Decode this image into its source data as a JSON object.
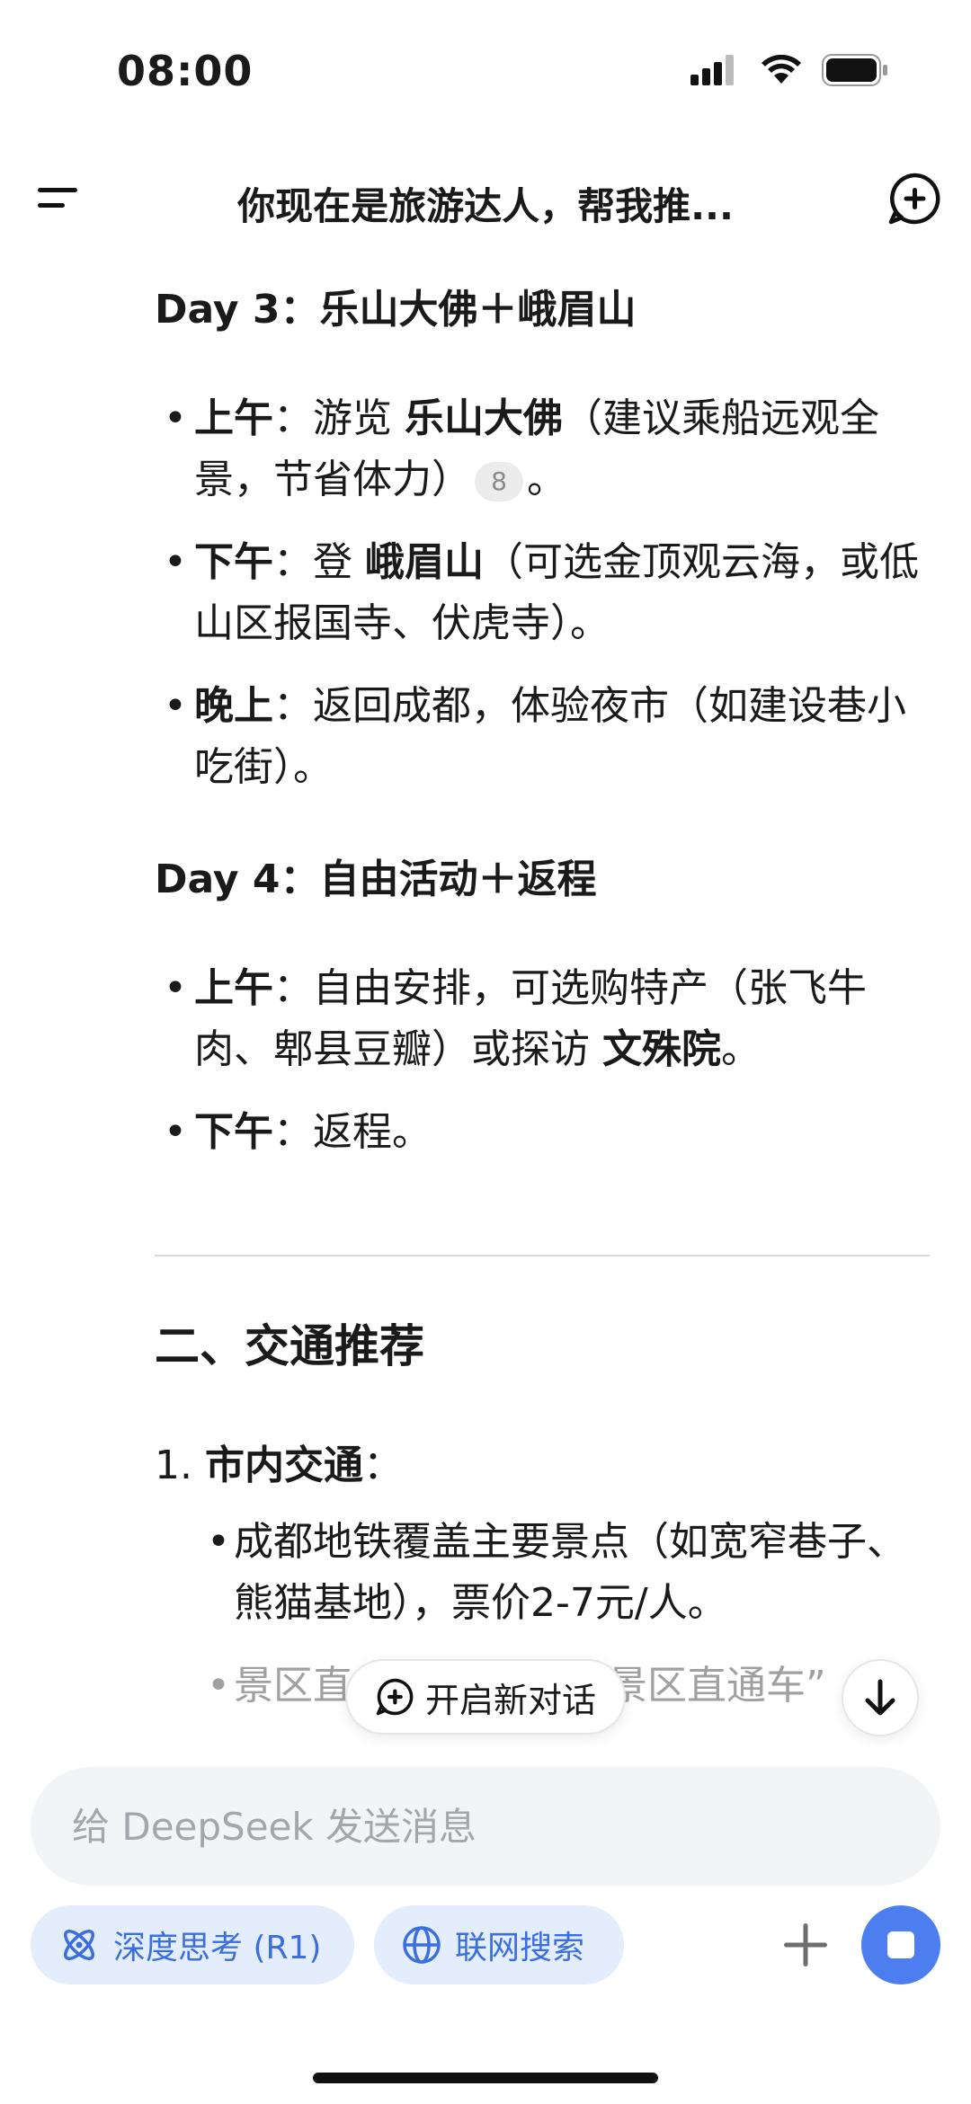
{
  "status_bar": {
    "time": "08:00"
  },
  "header": {
    "title": "你现在是旅游达人，帮我推..."
  },
  "content": {
    "day3": {
      "title": "Day 3：乐山大佛＋峨眉山",
      "items": [
        {
          "label": "上午",
          "sep": "：游览 ",
          "bold": "乐山大佛",
          "text": "（建议乘船远观全景，节省体力）",
          "cite": "8",
          "tail": "。"
        },
        {
          "label": "下午",
          "sep": "：登 ",
          "bold": "峨眉山",
          "text": "（可选金顶观云海，或低山区报国寺、伏虎寺）。"
        },
        {
          "label": "晚上",
          "text": "：返回成都，体验夜市（如建设巷小吃街）。"
        }
      ]
    },
    "day4": {
      "title": "Day 4：自由活动＋返程",
      "items": [
        {
          "label": "上午",
          "text": "：自由安排，可选购特产（张飞牛肉、郫县豆瓣）或探访 ",
          "bold": "文殊院",
          "tail": "。"
        },
        {
          "label": "下午",
          "text": "：返程。"
        }
      ]
    },
    "section2": {
      "title": "二、交通推荐",
      "ol1_num": "1.",
      "ol1_label": "市内交通",
      "ol1_sep": "：",
      "sub1": "成都地铁覆盖主要景点（如宽窄巷子、熊猫基地），票价2-7元/人。",
      "sub2_partial": "景区直",
      "sub2_partial_right": "景区直通车”"
    }
  },
  "floating": {
    "new_chat_label": "开启新对话"
  },
  "input": {
    "placeholder": "给 DeepSeek 发送消息"
  },
  "chips": {
    "deep_think": "深度思考 (R1)",
    "web_search": "联网搜索"
  },
  "colors": {
    "accent": "#4d7ef0",
    "chip_bg": "#e3edfc",
    "chip_text": "#3b6fe0"
  }
}
